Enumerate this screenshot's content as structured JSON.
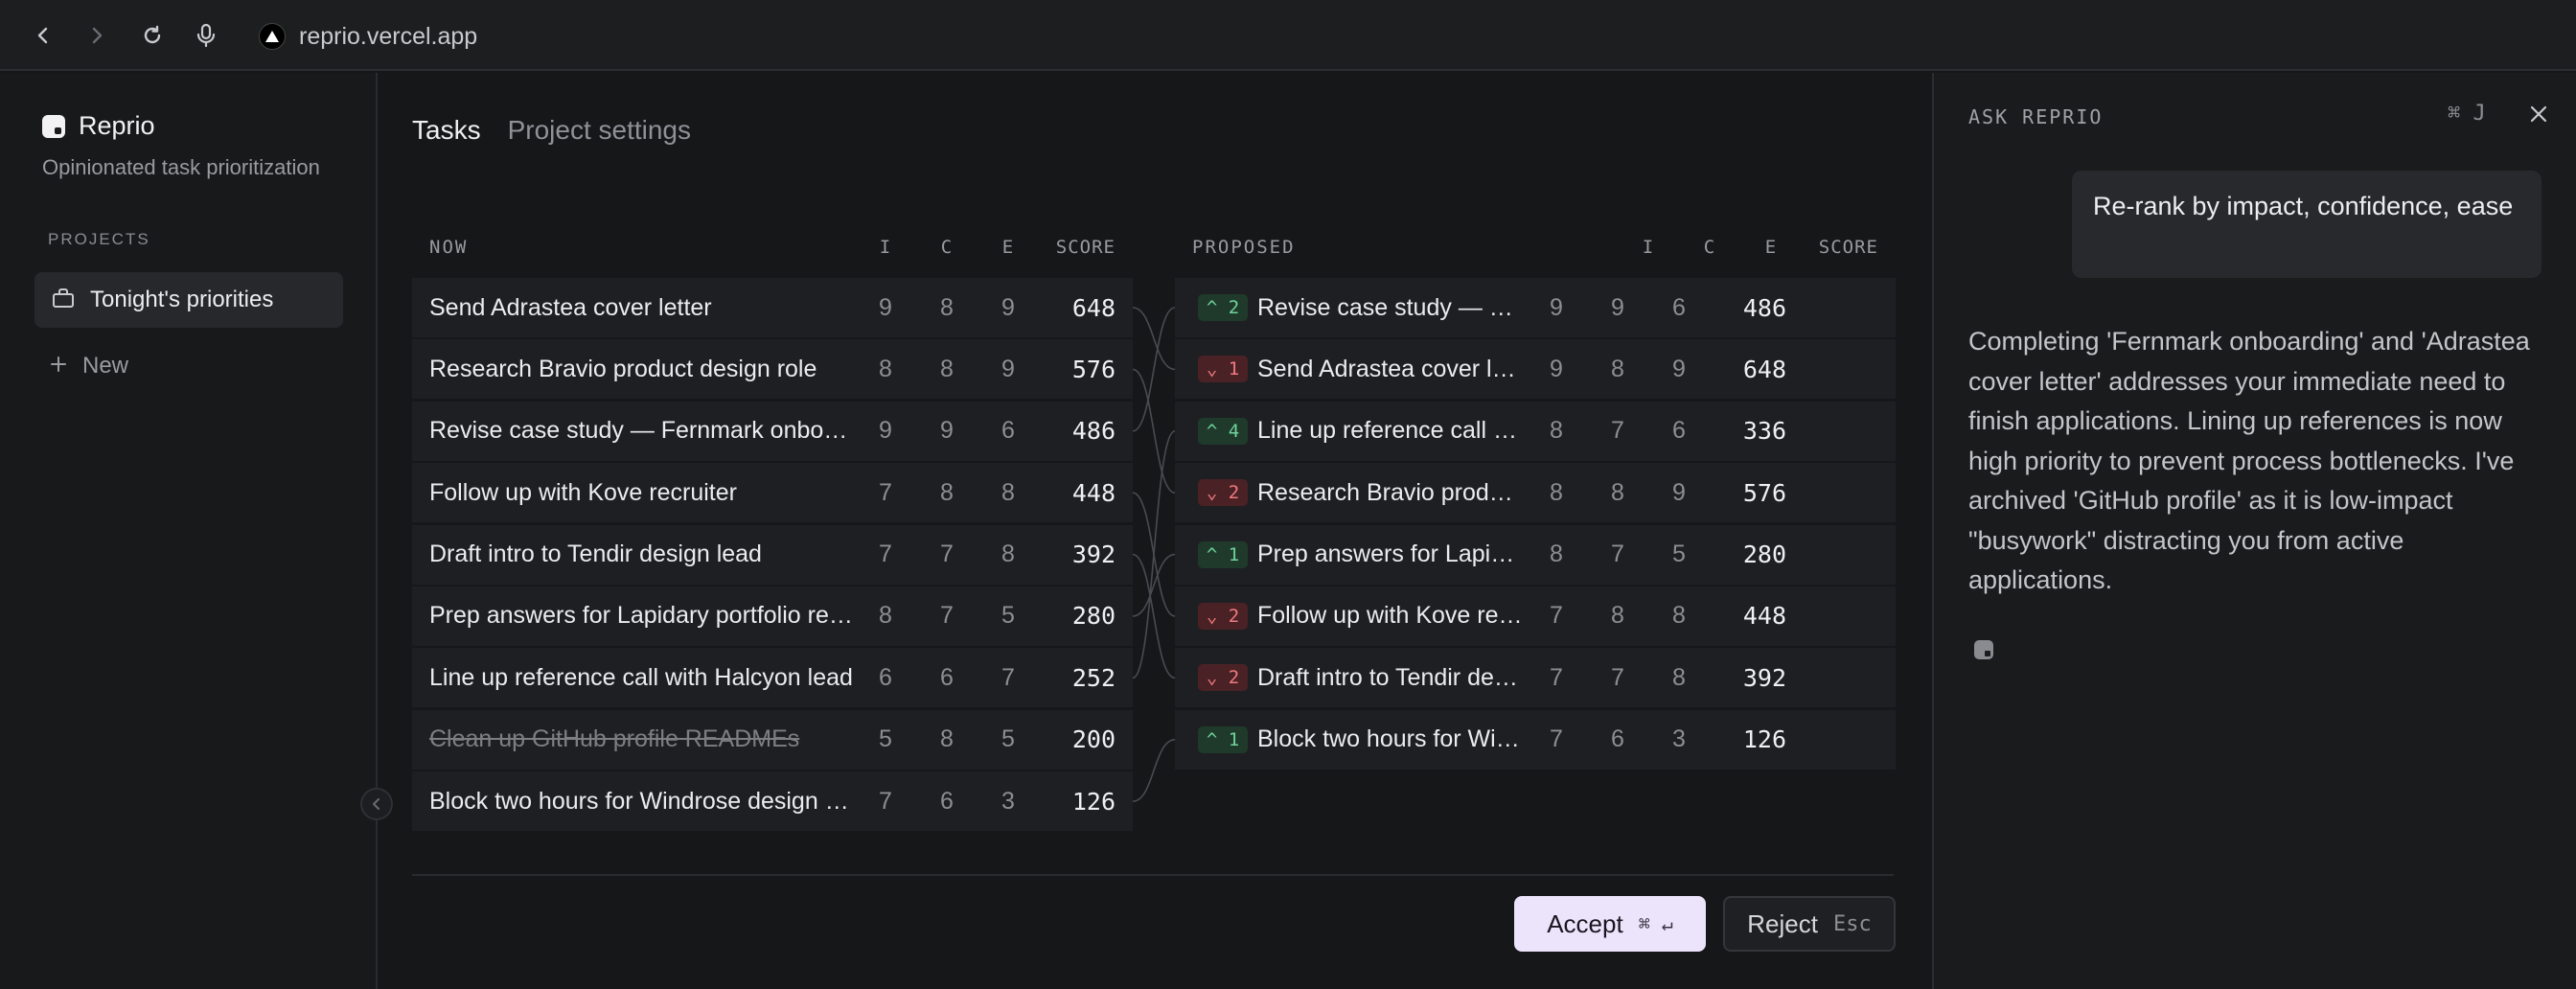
{
  "browser": {
    "url": "reprio.vercel.app"
  },
  "sidebar": {
    "app_name": "Reprio",
    "tagline": "Opinionated task prioritization",
    "section_label": "PROJECTS",
    "projects": [
      {
        "label": "Tonight's priorities",
        "icon": "bag-icon"
      }
    ],
    "new_label": "New"
  },
  "main": {
    "tabs": [
      {
        "label": "Tasks",
        "active": true
      },
      {
        "label": "Project settings",
        "active": false
      }
    ],
    "now": {
      "heading": "NOW",
      "columns": {
        "i": "I",
        "c": "C",
        "e": "E",
        "score": "SCORE"
      },
      "rows": [
        {
          "title": "Send Adrastea cover letter",
          "i": "9",
          "c": "8",
          "e": "9",
          "score": "648",
          "archived": false
        },
        {
          "title": "Research Bravio product design role",
          "i": "8",
          "c": "8",
          "e": "9",
          "score": "576",
          "archived": false
        },
        {
          "title": "Revise case study — Fernmark onboarding",
          "i": "9",
          "c": "9",
          "e": "6",
          "score": "486",
          "archived": false
        },
        {
          "title": "Follow up with Kove recruiter",
          "i": "7",
          "c": "8",
          "e": "8",
          "score": "448",
          "archived": false
        },
        {
          "title": "Draft intro to Tendir design lead",
          "i": "7",
          "c": "7",
          "e": "8",
          "score": "392",
          "archived": false
        },
        {
          "title": "Prep answers for Lapidary portfolio review",
          "i": "8",
          "c": "7",
          "e": "5",
          "score": "280",
          "archived": false
        },
        {
          "title": "Line up reference call with Halcyon lead",
          "i": "6",
          "c": "6",
          "e": "7",
          "score": "252",
          "archived": false
        },
        {
          "title": "Clean up GitHub profile READMEs",
          "i": "5",
          "c": "8",
          "e": "5",
          "score": "200",
          "archived": true
        },
        {
          "title": "Block two hours for Windrose design task",
          "i": "7",
          "c": "6",
          "e": "3",
          "score": "126",
          "archived": false
        }
      ]
    },
    "proposed": {
      "heading": "PROPOSED",
      "columns": {
        "i": "I",
        "c": "C",
        "e": "E",
        "score": "SCORE"
      },
      "rows": [
        {
          "delta": "^ 2",
          "dir": "up",
          "title": "Revise case study — Fernmark onboarding",
          "i": "9",
          "c": "9",
          "e": "6",
          "score": "486"
        },
        {
          "delta": "⌄ 1",
          "dir": "down",
          "title": "Send Adrastea cover letter",
          "i": "9",
          "c": "8",
          "e": "9",
          "score": "648"
        },
        {
          "delta": "^ 4",
          "dir": "up",
          "title": "Line up reference call with Halcyon lead",
          "i": "8",
          "c": "7",
          "e": "6",
          "score": "336"
        },
        {
          "delta": "⌄ 2",
          "dir": "down",
          "title": "Research Bravio product design role",
          "i": "8",
          "c": "8",
          "e": "9",
          "score": "576"
        },
        {
          "delta": "^ 1",
          "dir": "up",
          "title": "Prep answers for Lapidary portfolio review",
          "i": "8",
          "c": "7",
          "e": "5",
          "score": "280"
        },
        {
          "delta": "⌄ 2",
          "dir": "down",
          "title": "Follow up with Kove recruiter",
          "i": "7",
          "c": "8",
          "e": "8",
          "score": "448"
        },
        {
          "delta": "⌄ 2",
          "dir": "down",
          "title": "Draft intro to Tendir design lead",
          "i": "7",
          "c": "7",
          "e": "8",
          "score": "392"
        },
        {
          "delta": "^ 1",
          "dir": "up",
          "title": "Block two hours for Windrose design task",
          "i": "7",
          "c": "6",
          "e": "3",
          "score": "126"
        }
      ]
    },
    "accept": {
      "label": "Accept",
      "shortcut": "⌘ ↵"
    },
    "reject": {
      "label": "Reject",
      "shortcut": "Esc"
    }
  },
  "panel": {
    "title": "ASK REPRIO",
    "shortcut": "⌘ J",
    "user_message": "Re-rank by impact, confidence, ease",
    "reply": "Completing 'Fernmark onboarding' and 'Adrastea cover letter' addresses your immediate need to finish applications. Lining up references is now high priority to prevent process bottlenecks. I've archived 'GitHub profile' as it is low-impact \"busywork\" distracting you from active applications."
  },
  "colors": {
    "accent": "#ece4fb",
    "up": "#6fd39a",
    "down": "#ef7a7e",
    "background": "#161719"
  }
}
